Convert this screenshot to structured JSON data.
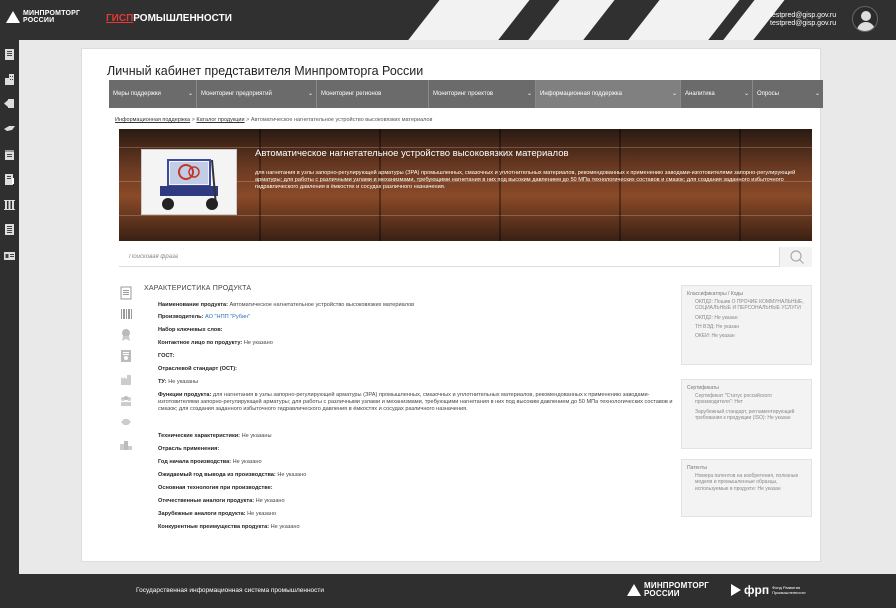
{
  "header": {
    "logo_line1": "МИНПРОМТОРГ",
    "logo_line2": "РОССИИ",
    "gisp_red": "ГИСП",
    "gisp_rest": "РОМЫШЛЕННОСТИ",
    "email1": "testpred@gisp.gov.ru",
    "email2": "testpred@gisp.gov.ru"
  },
  "sidebar": {
    "icons": [
      "document-icon",
      "building-icon",
      "arrow-icon",
      "bird-icon",
      "calendar-icon",
      "document-edit-icon",
      "bar-chart-icon",
      "list-document-icon",
      "id-card-icon"
    ]
  },
  "page": {
    "title": "Личный кабинет представителя Минпромторга России"
  },
  "menu": {
    "items": [
      {
        "label": "Меры поддержки",
        "chev": "⌄"
      },
      {
        "label": "Мониторинг предприятий",
        "chev": "⌄"
      },
      {
        "label": "Мониторинг регионов",
        "chev": ""
      },
      {
        "label": "Мониторинг проектов",
        "chev": "⌄"
      },
      {
        "label": "Информационная поддержка",
        "chev": "⌄"
      },
      {
        "label": "Аналитика",
        "chev": "⌄"
      },
      {
        "label": "Опросы",
        "chev": "⌄"
      }
    ]
  },
  "breadcrumb": {
    "link1": "Информационная поддержка",
    "sep": ">",
    "link2": "Каталог продукции",
    "current": "Автоматическое нагнетательное устройство высоковязких материалов"
  },
  "hero": {
    "title": "Автоматическое нагнетательное устройство высоковязких материалов",
    "description": "для нагнетания в узлы запорно-регулирующей арматуры (ЗРА) промышленных, смазочных и уплотнительных материалов, рекомендованных к применению заводами-изготовителями запорно-регулирующей арматуры; для работы с различными узлами и механизмами, требующими нагнетания в них под высоким давлением до 50 МПа технологических составов и смазок; для создания заданного избыточного гидравлического давления в ёмкостях и сосудах различного назначения."
  },
  "search": {
    "placeholder": "Поисковая фраза"
  },
  "characteristics": {
    "title": "ХАРАКТЕРИСТИКА ПРОДУКТА",
    "name_label": "Наименование продукта:",
    "name_value": "Автоматическое нагнетательное устройство высоковязких материалов",
    "manufacturer_label": "Производитель:",
    "manufacturer_value": "АО \"НПП \"Рубин\"",
    "keywords_label": "Набор ключевых слов:",
    "contact_label": "Контактное лицо по продукту:",
    "contact_value": "Не указано",
    "gost_label": "ГОСТ:",
    "ost_label": "Отраслевой стандарт (ОСТ):",
    "tu_label": "ТУ:",
    "tu_value": "Не указаны",
    "functions_label": "Функции продукта:",
    "functions_value": "для нагнетания в узлы запорно-регулирующей арматуры (ЗРА) промышленных, смазочных и уплотнительных материалов, рекомендованных к применению заводами-изготовителями запорно-регулирующей арматуры; для работы с различными узлами и механизмами, требующими нагнетания в них под высоким давлением до 50 МПа технологических составов и смазок; для создания заданного избыточного гидравлического давления в ёмкостях и сосудах различного назначения.",
    "tech_label": "Технические характеристики:",
    "tech_value": "Не указаны",
    "industry_label": "Отрасль применения:",
    "start_year_label": "Год начала производства:",
    "start_year_value": "Не указано",
    "end_year_label": "Ожидаемый год вывода из производства:",
    "end_year_value": "Не указано",
    "tech_base_label": "Основная технология при производстве:",
    "domestic_label": "Отечественные аналоги продукта:",
    "domestic_value": "Не указано",
    "foreign_label": "Зарубежные аналоги продукта:",
    "foreign_value": "Не указано",
    "competitive_label": "Конкурентные преимущества продукта:",
    "competitive_value": "Не указано"
  },
  "classifiers": {
    "title": "Классификаторы / Коды",
    "okpd2": "ОКПД2: Пошив О ПРОЧИЕ КОММУНАЛЬНЫЕ, СОЦИАЛЬНЫЕ И ПЕРСОНАЛЬНЫЕ УСЛУГИ",
    "okpd": "ОКПД2: Не указан",
    "tnved": "ТН ВЭД: Не указан",
    "okei": "ОКЕИ: Не указан"
  },
  "certificates": {
    "title": "Сертификаты",
    "cert1": "Сертификат \"Статус российского производителя\": Нет",
    "cert2": "Зарубежный стандарт, регламентирующий требования к продукции (ISO): Не указан"
  },
  "patents": {
    "title": "Патенты",
    "text": "Номера патентов на изобретения, полезные модели и промышленные образцы, используемые в продукте: Не указан"
  },
  "footer": {
    "text": "Государственная информационная система промышленности",
    "logo_line1": "МИНПРОМТОРГ",
    "logo_line2": "РОССИИ",
    "frp_name": "фрп",
    "frp_small1": "Фонд Развития",
    "frp_small2": "Промышленности"
  }
}
